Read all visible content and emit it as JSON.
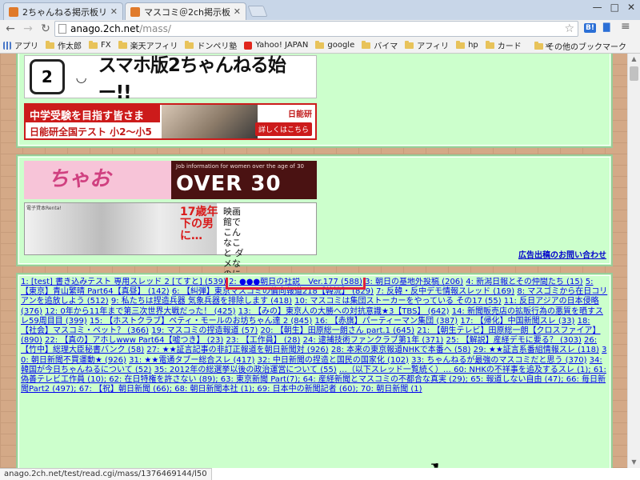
{
  "browser": {
    "tabs": [
      {
        "title": "2ちゃんねる掲示板リスト",
        "active": false,
        "favicon_color": "#e07a2a"
      },
      {
        "title": "マスコミ＠2ch掲示板",
        "active": true,
        "favicon_color": "#e07a2a"
      }
    ],
    "window_controls": [
      "—",
      "□",
      "✕"
    ],
    "address": {
      "host": "anago.2ch.net",
      "path": "/mass/"
    },
    "nav_icons": [
      "back-arrow-icon",
      "forward-arrow-icon",
      "reload-icon"
    ],
    "bookmarks": [
      {
        "label": "アプリ",
        "type": "apps"
      },
      {
        "label": "作太郎",
        "type": "folder"
      },
      {
        "label": "FX",
        "type": "folder"
      },
      {
        "label": "楽天アフィリ",
        "type": "folder"
      },
      {
        "label": "ドンペリ塾",
        "type": "folder"
      },
      {
        "label": "Yahoo! JAPAN",
        "type": "site"
      },
      {
        "label": "google",
        "type": "folder"
      },
      {
        "label": "バイマ",
        "type": "folder"
      },
      {
        "label": "アフィリ",
        "type": "folder"
      },
      {
        "label": "hp",
        "type": "folder"
      },
      {
        "label": "カード",
        "type": "folder"
      }
    ],
    "bookmarks_more": "»",
    "other_bookmarks": "その他のブックマーク",
    "status_url": "anago.2ch.net/test/read.cgi/mass/1376469144/l50"
  },
  "ads": {
    "smapho": {
      "text": "スマホ版2ちゃんねる始ー!!",
      "icon_text": "2"
    },
    "nichino": {
      "headline": "中学受験を目指す皆さま",
      "sub": "日能研全国テスト 小2～小5",
      "brand": "日能研",
      "more": "詳しくはこちら"
    },
    "chao": {
      "left": "ちゃお",
      "small": "Job information for women over the age of 30",
      "big": "OVER 30"
    },
    "manga": {
      "label": "電子貸本Renta!",
      "red": "17歳年下の男に…",
      "side": "映画館でこんなこと ダメなのに"
    },
    "contact": "広告出稿のお問い合わせ"
  },
  "threads": [
    {
      "num": "1",
      "title": "[test] 書き込みテスト 専用スレッド 2 [てすと]",
      "count": "539"
    },
    {
      "num": "2",
      "title": "●●●朝日の社説　Ver.177",
      "count": "588",
      "highlight": true
    },
    {
      "num": "3",
      "title": "朝日の基地外投稿",
      "count": "206"
    },
    {
      "num": "4",
      "title": "新潟日報とその仲間たち",
      "count": "15"
    },
    {
      "num": "5",
      "title": "【東京】青山繁晴 Part64【真昼】",
      "count": "142"
    },
    {
      "num": "6",
      "title": "【糾弾】東京マスコミの偏向報道218【韓流】",
      "count": "829"
    },
    {
      "num": "7",
      "title": "反韓・反中デモ情報スレッド",
      "count": "169"
    },
    {
      "num": "8",
      "title": "マスゴミから在日コリアンを追放しよう",
      "count": "512"
    },
    {
      "num": "9",
      "title": "私たちは捏造兵器 気象兵器を排除します",
      "count": "418"
    },
    {
      "num": "10",
      "title": "マスコミは集団ストーカーをやっている その17",
      "count": "55"
    },
    {
      "num": "11",
      "title": "反日アジアの日本侵略",
      "count": "376"
    },
    {
      "num": "12",
      "title": "0年から11年まで第三次世界大戦だった！",
      "count": "425"
    },
    {
      "num": "13",
      "title": "【みの】東京人の大勝への対抗意識★3【TBS】",
      "count": "642"
    },
    {
      "num": "14",
      "title": "新聞販売店の拡販行為の悪質を晒すスレ59周目目",
      "count": "399"
    },
    {
      "num": "15",
      "title": "【ホストクラブ】ペティ・モールのお坊ちゃん達 2",
      "count": "845"
    },
    {
      "num": "16",
      "title": "【赤旗】パーティーマン集団",
      "count": "387"
    },
    {
      "num": "17",
      "title": "【帰化】中国新聞スレ",
      "count": "33"
    },
    {
      "num": "18",
      "title": "【社会】マスコミ・ペット？",
      "count": "366"
    },
    {
      "num": "19",
      "title": "マスコミの捏造報道",
      "count": "57"
    },
    {
      "num": "20",
      "title": "【朝生】田原総一朗さん part.1",
      "count": "645"
    },
    {
      "num": "21",
      "title": "【朝生テレビ】田原総一朗【クロスファイア】",
      "count": "890"
    },
    {
      "num": "22",
      "title": "【真の】アホしwww Part64【嘘つき】",
      "count": "23"
    },
    {
      "num": "23",
      "title": "【工作員】",
      "count": "28"
    },
    {
      "num": "24",
      "title": "逮捕技術ファンクラブ第1年",
      "count": "371"
    },
    {
      "num": "25",
      "title": "【解説】産経デモに要る？",
      "count": "303"
    },
    {
      "num": "26",
      "title": "【竹中】総理大臣秘書バンク",
      "count": "58"
    },
    {
      "num": "27",
      "title": "★★証言記事の非訂正報道を朝日新聞対",
      "count": "926"
    },
    {
      "num": "28",
      "title": "本来の東京報道NHKで本番へ",
      "count": "58"
    },
    {
      "num": "29",
      "title": "★★証言系番組情報スレ",
      "count": "118"
    },
    {
      "num": "30",
      "title": "朝日新聞不買運動★",
      "count": "926"
    },
    {
      "num": "31",
      "title": "★★電通タブー総合スレ",
      "count": "417"
    },
    {
      "num": "32",
      "title": "中日新聞の捏造と国民の国家化",
      "count": "102"
    },
    {
      "num": "33",
      "title": "ちゃんねるが最強のマスコミだと思う",
      "count": "370"
    },
    {
      "num": "34",
      "title": "韓国が今日ちゃんねるについて",
      "count": "52"
    },
    {
      "num": "35",
      "title": "2012年の総選挙以後の政治運営について",
      "count": "55"
    }
  ],
  "threads_tail": "…（以下スレッド一覧続く）… 60: NHKの不祥事を追及するスレ (1); 61: 偽善テレビ工作員 (10); 62: 在日特権を許さない (89); 63: 東京新聞 Part(7); 64: 産経新聞とマスコミの不都合な真実 (29); 65: 報道しない自由 (47); 66: 毎日新聞Part2 (497); 67: 【祝】朝日新聞 (66); 68: 朝日新聞本社 (1); 69: 日本中の新聞記者 (60); 70: 朝日新聞 (1)"
}
